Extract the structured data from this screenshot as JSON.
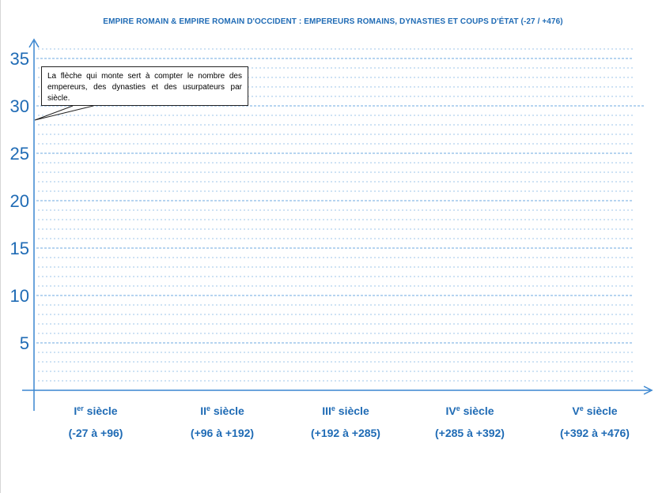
{
  "title": "EMPIRE ROMAIN & EMPIRE ROMAIN D'OCCIDENT : EMPEREURS ROMAINS, DYNASTIES ET COUPS D'ÉTAT (-27 / +476)",
  "callout": {
    "text": "La flèche qui monte sert à compter le nombre des empereurs, des dynasties et des usurpateurs par siècle."
  },
  "colors": {
    "accent": "#1f6bb5",
    "axis": "#3a86d0",
    "grid": "#9cc4ea"
  },
  "chart_data": {
    "type": "bar",
    "title": "EMPIRE ROMAIN & EMPIRE ROMAIN D'OCCIDENT : EMPEREURS ROMAINS, DYNASTIES ET COUPS D'ÉTAT (-27 / +476)",
    "ylim": [
      0,
      36
    ],
    "yticks": [
      "5",
      "10",
      "15",
      "20",
      "25",
      "30",
      "35"
    ],
    "minor_step": 1,
    "categories": [
      {
        "num": "I",
        "sup": "er",
        "word": " siècle",
        "range": "(-27 à +96)"
      },
      {
        "num": "II",
        "sup": "e",
        "word": " siècle",
        "range": "(+96 à +192)"
      },
      {
        "num": "III",
        "sup": "e",
        "word": " siècle",
        "range": "(+192 à +285)"
      },
      {
        "num": "IV",
        "sup": "e",
        "word": " siècle",
        "range": "(+285 à +392)"
      },
      {
        "num": "V",
        "sup": "e",
        "word": " siècle",
        "range": "(+392 à +476)"
      }
    ],
    "series": []
  }
}
